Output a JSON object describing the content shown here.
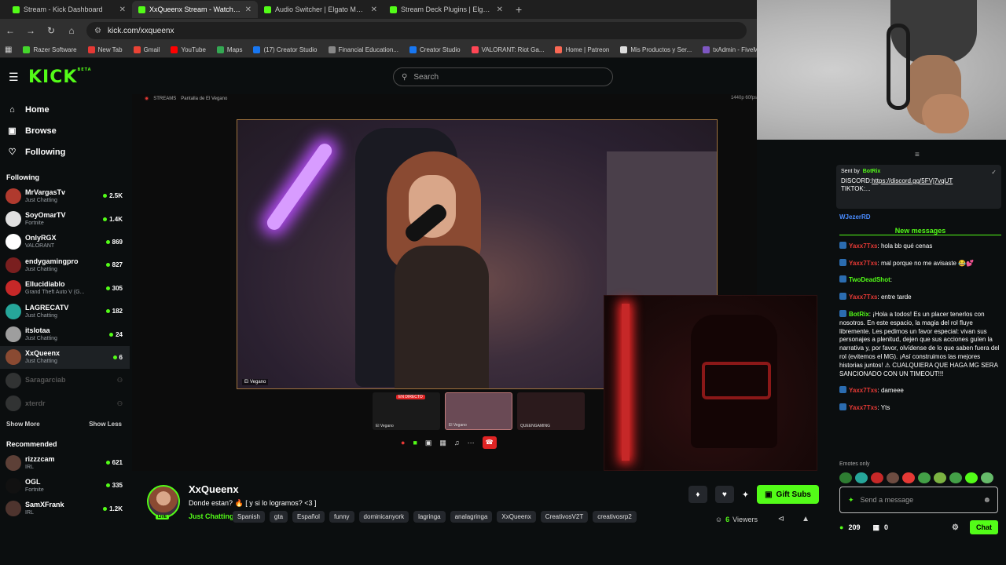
{
  "browser": {
    "tabs": [
      {
        "title": "Stream - Kick Dashboard",
        "active": false
      },
      {
        "title": "XxQueenx Stream - Watch Live",
        "active": true
      },
      {
        "title": "Audio Switcher | Elgato Marketplace",
        "active": false
      },
      {
        "title": "Stream Deck Plugins | Elgato M",
        "active": false
      }
    ],
    "new_tab": "+",
    "url": "kick.com/xxqueenx",
    "bookmarks": [
      {
        "label": "Razer Software",
        "color": "#44d62c"
      },
      {
        "label": "New Tab",
        "color": "#e53935"
      },
      {
        "label": "Gmail",
        "color": "#ea4335"
      },
      {
        "label": "YouTube",
        "color": "#ff0000"
      },
      {
        "label": "Maps",
        "color": "#34a853"
      },
      {
        "label": "(17) Creator Studio",
        "color": "#1877f2"
      },
      {
        "label": "Financial Education...",
        "color": "#888888"
      },
      {
        "label": "Creator Studio",
        "color": "#1877f2"
      },
      {
        "label": "VALORANT: Riot Ga...",
        "color": "#ff4655"
      },
      {
        "label": "Home | Patreon",
        "color": "#f96854"
      },
      {
        "label": "Mis Productos y Ser...",
        "color": "#dddddd"
      },
      {
        "label": "txAdmin - FiveM/Re",
        "color": "#7e57c2"
      }
    ]
  },
  "kick": {
    "logo": "KICK",
    "logo_beta": "BETA",
    "search_placeholder": "Search",
    "brand_color": "#53fc18"
  },
  "sidebar": {
    "nav": [
      {
        "label": "Home",
        "icon": "home-icon"
      },
      {
        "label": "Browse",
        "icon": "browse-icon"
      },
      {
        "label": "Following",
        "icon": "heart-icon"
      }
    ],
    "following_title": "Following",
    "following": [
      {
        "name": "MrVargasTv",
        "category": "Just Chatting",
        "viewers": "2.5K",
        "color": "#b03a2e",
        "active": false,
        "offline": false
      },
      {
        "name": "SoyOmarTV",
        "category": "Fortnite",
        "viewers": "1.4K",
        "color": "#e0e0e0",
        "active": false,
        "offline": false
      },
      {
        "name": "OnlyRGX",
        "category": "VALORANT",
        "viewers": "869",
        "color": "#ffffff",
        "active": false,
        "offline": false
      },
      {
        "name": "endygamingpro",
        "category": "Just Chatting",
        "viewers": "827",
        "color": "#7a1f1f",
        "active": false,
        "offline": false
      },
      {
        "name": "Ellucidiablo",
        "category": "Grand Theft Auto V (G...",
        "viewers": "305",
        "color": "#c62828",
        "active": false,
        "offline": false
      },
      {
        "name": "LAGRECATV",
        "category": "Just Chatting",
        "viewers": "182",
        "color": "#26a69a",
        "active": false,
        "offline": false
      },
      {
        "name": "itslotaa",
        "category": "Just Chatting",
        "viewers": "24",
        "color": "#9e9e9e",
        "active": false,
        "offline": false
      },
      {
        "name": "XxQueenx",
        "category": "Just Chatting",
        "viewers": "6",
        "color": "#8a4a32",
        "active": true,
        "offline": false
      },
      {
        "name": "Saragarciab",
        "category": "",
        "viewers": "",
        "color": "#777777",
        "active": false,
        "offline": true
      },
      {
        "name": "xterdr",
        "category": "",
        "viewers": "",
        "color": "#777777",
        "active": false,
        "offline": true
      }
    ],
    "show_more": "Show More",
    "show_less": "Show Less",
    "recommended_title": "Recommended",
    "recommended": [
      {
        "name": "rizzzcam",
        "category": "IRL",
        "viewers": "621",
        "color": "#5d4037"
      },
      {
        "name": "OGL",
        "category": "Fortnite",
        "viewers": "335",
        "color": "#111111"
      },
      {
        "name": "SamXFrank",
        "category": "IRL",
        "viewers": "1.2K",
        "color": "#4e342e"
      }
    ]
  },
  "player": {
    "studio_path": "STREAMS",
    "scene_name": "Pantalla de El Vegano",
    "resolution": "1440p 60fps",
    "cam_label": "El Vegano",
    "scenes": [
      {
        "label": "El Vegano",
        "live": "EN DIRECTO"
      },
      {
        "label": "El Vegano",
        "live": ""
      },
      {
        "label": "QUEENGAMING",
        "live": ""
      }
    ]
  },
  "stream": {
    "username": "XxQueenx",
    "live_badge": "LIVE",
    "title": "Donde estan? 🔥 [ y si lo logramos? <3 ]",
    "category": "Just Chatting",
    "tags": [
      "Spanish",
      "gta",
      "Español",
      "funny",
      "dominicanyork",
      "lagringa",
      "analagringa",
      "XxQueenx",
      "CreativosV2T",
      "creativosrp2"
    ],
    "gift_label": "Gift Subs",
    "viewers_count": "6",
    "viewers_label": "Viewers"
  },
  "chat": {
    "pinned": {
      "sent_by": "Sent by",
      "bot_name": "BotRix",
      "line1_prefix": "DISCORD:",
      "line1_link": "https://discord.gg/5FVj7vqUT",
      "line2": "TIKTOK:..."
    },
    "first_user": "WJezerRD",
    "new_messages": "New messages",
    "messages": [
      {
        "user": "Yaxx7Txs",
        "color": "#e53935",
        "text": "hola bb qué cenas"
      },
      {
        "user": "Yaxx7Txs",
        "color": "#e53935",
        "text": "mal porque no me avisaste 😂💕"
      },
      {
        "user": "TwoDeadShot",
        "color": "#53fc18",
        "text": ""
      },
      {
        "user": "Yaxx7Txs",
        "color": "#e53935",
        "text": "entre tarde"
      },
      {
        "user": "BotRix",
        "color": "#53fc18",
        "text": "¡Hola a todos! Es un placer tenerlos con nosotros. En este espacio, la magia del rol fluye libremente. Les pedimos un favor especial: vivan sus personajes a plenitud, dejen que sus acciones guíen la narrativa y, por favor, olvídense de lo que saben fuera del rol (evitemos el MG). ¡Así construimos las mejores historias juntos! ⚠ CUALQUIERA QUE HAGA MG SERA SANCIONADO CON UN TIMEOUT!!!"
      },
      {
        "user": "Yaxx7Txs",
        "color": "#e53935",
        "text": "dameee"
      },
      {
        "user": "Yaxx7Txs",
        "color": "#e53935",
        "text": "Yts"
      }
    ],
    "emotes_only": "Emotes only",
    "input_placeholder": "Send a message",
    "points": "209",
    "subs": "0",
    "chat_button": "Chat"
  }
}
